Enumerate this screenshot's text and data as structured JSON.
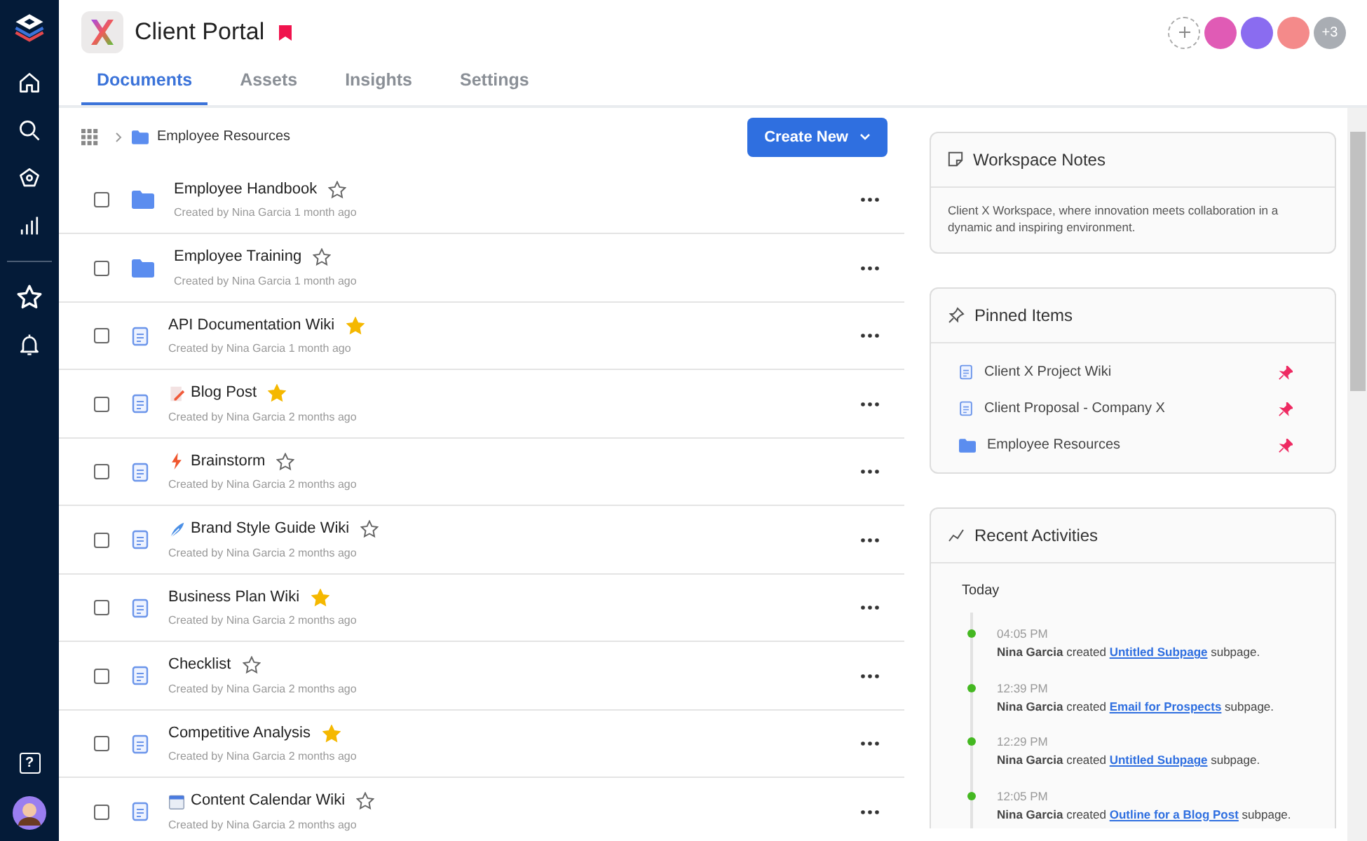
{
  "workspace": {
    "title": "Client Portal",
    "bookmarked": true
  },
  "sidebar": {
    "help": "?"
  },
  "members": {
    "more": "+3",
    "avatars": [
      {
        "color": "#e05bb5"
      },
      {
        "color": "#8a6cf0"
      },
      {
        "color": "#f48a8a"
      }
    ]
  },
  "tabs": [
    {
      "label": "Documents",
      "selected": true
    },
    {
      "label": "Assets",
      "selected": false
    },
    {
      "label": "Insights",
      "selected": false
    },
    {
      "label": "Settings",
      "selected": false
    }
  ],
  "breadcrumb": {
    "current": "Employee Resources"
  },
  "create_button": "Create New",
  "documents": [
    {
      "kind": "folder",
      "title": "Employee Handbook",
      "meta": "Created by Nina Garcia 1 month ago",
      "starred": false,
      "checked": false
    },
    {
      "kind": "folder",
      "title": "Employee Training",
      "meta": "Created by Nina Garcia 1 month ago",
      "starred": false,
      "checked": false
    },
    {
      "kind": "page",
      "title": "API Documentation Wiki",
      "meta": "Created by Nina Garcia 1 month ago",
      "starred": true,
      "checked": false
    },
    {
      "kind": "page",
      "title_icon": {
        "kind": "memo"
      },
      "title": "Blog Post",
      "meta": "Created by Nina Garcia 2 months ago",
      "starred": true,
      "checked": false
    },
    {
      "kind": "page",
      "title_icon": {
        "kind": "bolt"
      },
      "title": "Brainstorm",
      "meta": "Created by Nina Garcia 2 months ago",
      "starred": false,
      "checked": false
    },
    {
      "kind": "page",
      "title_icon": {
        "kind": "quill"
      },
      "title": "Brand Style Guide Wiki",
      "meta": "Created by Nina Garcia 2 months ago",
      "starred": false,
      "checked": false
    },
    {
      "kind": "page",
      "title": "Business Plan Wiki",
      "meta": "Created by Nina Garcia 2 months ago",
      "starred": true,
      "checked": false
    },
    {
      "kind": "page",
      "title": "Checklist",
      "meta": "Created by Nina Garcia 2 months ago",
      "starred": false,
      "checked": false
    },
    {
      "kind": "page",
      "title": "Competitive Analysis",
      "meta": "Created by Nina Garcia 2 months ago",
      "starred": true,
      "checked": false
    },
    {
      "kind": "page",
      "title_icon": {
        "kind": "calendar"
      },
      "title": "Content Calendar Wiki",
      "meta": "Created by Nina Garcia 2 months ago",
      "starred": false,
      "checked": false
    }
  ],
  "notes": {
    "title": "Workspace Notes",
    "text": "Client X Workspace, where innovation meets collaboration in a dynamic and inspiring environment."
  },
  "pinned": {
    "title": "Pinned Items",
    "items": [
      {
        "kind": "page",
        "label": "Client X Project Wiki",
        "pinned": true
      },
      {
        "kind": "page",
        "label": "Client Proposal - Company X",
        "pinned": true
      },
      {
        "kind": "folder",
        "label": "Employee Resources",
        "pinned": true
      }
    ]
  },
  "activities": {
    "title": "Recent Activities",
    "day": "Today",
    "items": [
      {
        "time": "04:05 PM",
        "text_before": "**Nina Garcia** created",
        "link": "Untitled Subpage",
        "text_after": "subpage."
      },
      {
        "time": "12:39 PM",
        "text_before": "**Nina Garcia** created",
        "link": "Email for Prospects",
        "text_after": "subpage."
      },
      {
        "time": "12:29 PM",
        "text_before": "**Nina Garcia** created",
        "link": "Untitled Subpage",
        "text_after": "subpage."
      },
      {
        "time": "12:05 PM",
        "text_before": "**Nina Garcia** created",
        "link": "Outline for a Blog Post",
        "text_after": "subpage."
      }
    ]
  }
}
